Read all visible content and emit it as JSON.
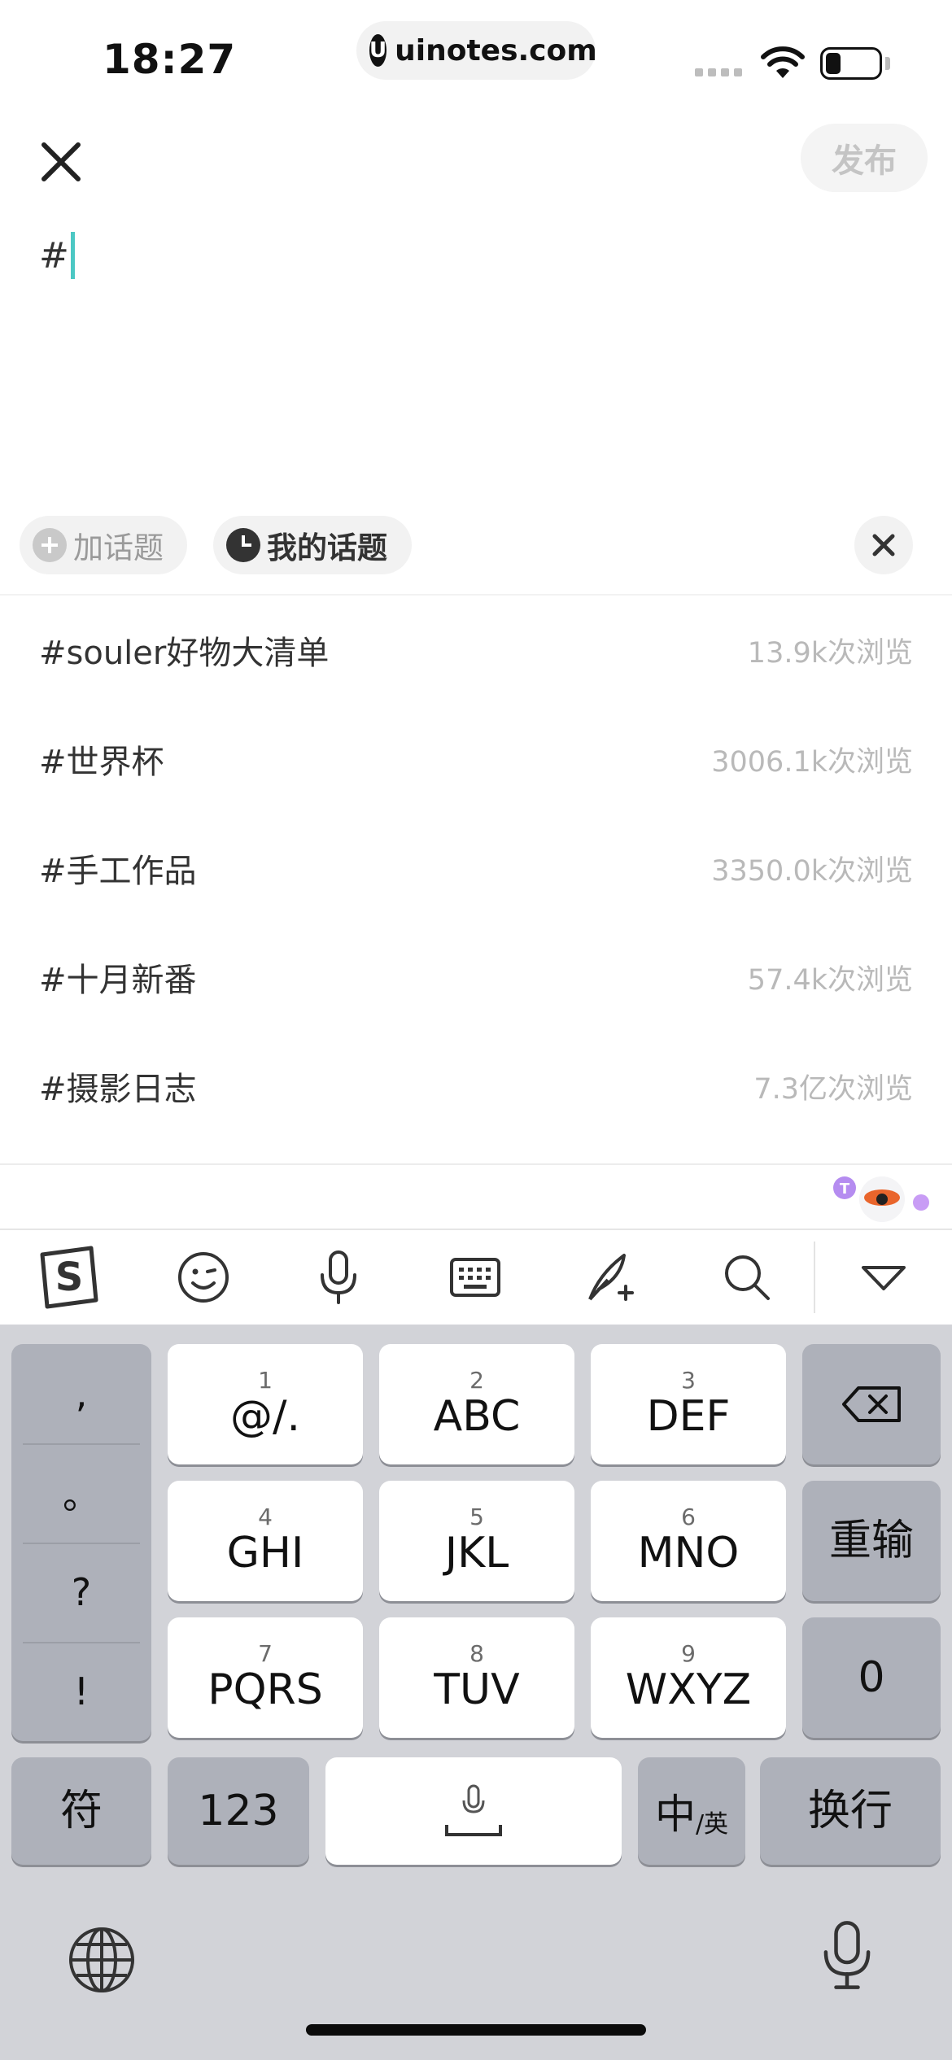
{
  "status_bar": {
    "time": "18:27",
    "url": "uinotes.com",
    "url_logo": "U"
  },
  "header": {
    "publish_label": "发布"
  },
  "editor": {
    "text": "#"
  },
  "chips": {
    "add_topic": "加话题",
    "my_topics": "我的话题"
  },
  "topics": [
    {
      "name": "#souler好物大清单",
      "views": "13.9k次浏览"
    },
    {
      "name": "#世界杯",
      "views": "3006.1k次浏览"
    },
    {
      "name": "#手工作品",
      "views": "3350.0k次浏览"
    },
    {
      "name": "#十月新番",
      "views": "57.4k次浏览"
    },
    {
      "name": "#摄影日志",
      "views": "7.3亿次浏览"
    }
  ],
  "keyboard": {
    "punctuation": [
      ",",
      "。",
      "?",
      "!"
    ],
    "keys": [
      {
        "num": "1",
        "label": "@/."
      },
      {
        "num": "2",
        "label": "ABC"
      },
      {
        "num": "3",
        "label": "DEF"
      },
      {
        "num": "4",
        "label": "GHI"
      },
      {
        "num": "5",
        "label": "JKL"
      },
      {
        "num": "6",
        "label": "MNO"
      },
      {
        "num": "7",
        "label": "PQRS"
      },
      {
        "num": "8",
        "label": "TUV"
      },
      {
        "num": "9",
        "label": "WXYZ"
      }
    ],
    "reenter": "重输",
    "zero": "0",
    "symbols": "符",
    "numbers": "123",
    "lang_main": "中",
    "lang_sub": "/英",
    "return": "换行"
  },
  "icons": {
    "close": "close-icon",
    "toolbar": [
      "sogou-logo-icon",
      "emoji-icon",
      "microphone-icon",
      "keyboard-icon",
      "handwriting-icon",
      "search-icon",
      "collapse-keyboard-icon"
    ],
    "bottom": [
      "globe-icon",
      "dictation-microphone-icon"
    ]
  },
  "colors": {
    "caret": "#4cc8c4",
    "keyboard_bg": "#d2d3d8"
  }
}
